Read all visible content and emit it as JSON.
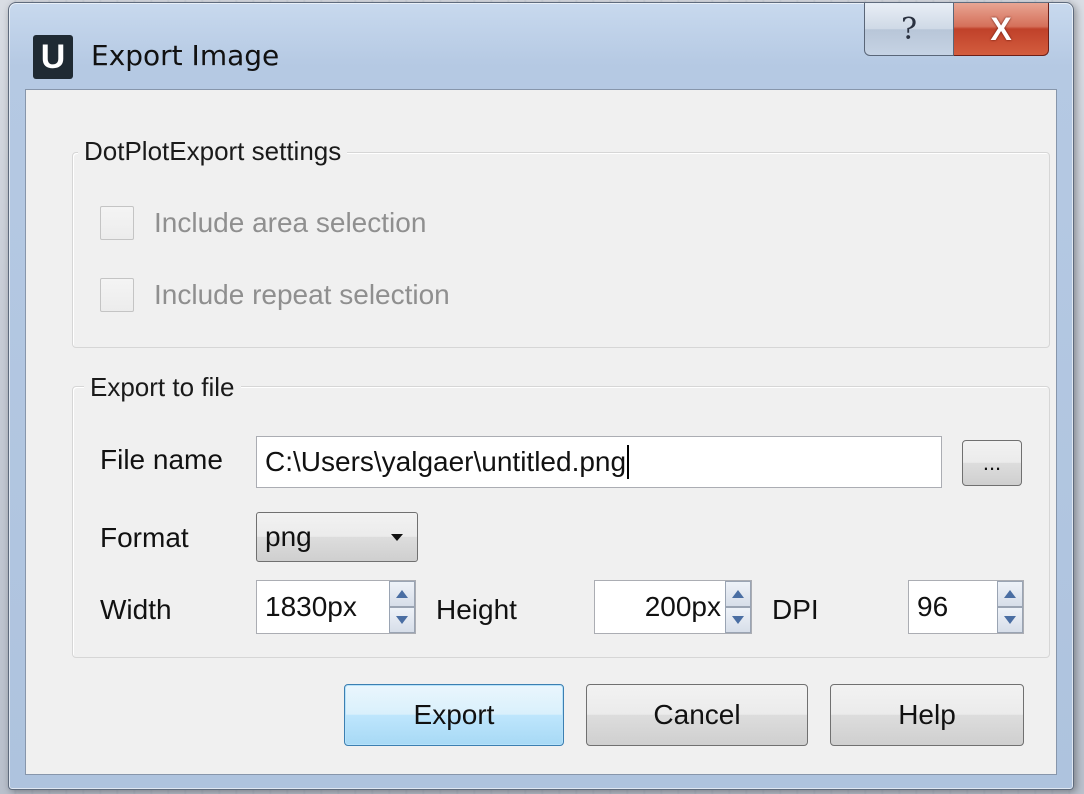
{
  "window": {
    "title": "Export Image",
    "app_icon_letter": "U",
    "help_glyph": "?",
    "close_glyph": "X"
  },
  "settings_group": {
    "title": "DotPlotExport settings",
    "include_area_label": "Include area selection",
    "include_repeat_label": "Include repeat selection",
    "include_area_checked": false,
    "include_repeat_checked": false
  },
  "export_group": {
    "title": "Export to file",
    "file_name_label": "File name",
    "file_name_value": "C:\\Users\\yalgaer\\untitled.png",
    "browse_label": "...",
    "format_label": "Format",
    "format_value": "png",
    "width_label": "Width",
    "width_value": "1830px",
    "height_label": "Height",
    "height_value": "200px",
    "dpi_label": "DPI",
    "dpi_value": "96"
  },
  "buttons": {
    "export": "Export",
    "cancel": "Cancel",
    "help": "Help"
  },
  "icons": {
    "app": "ugene-app-icon",
    "help": "help-question-icon",
    "close": "close-x-icon",
    "dropdown": "chevron-down-icon",
    "spin_up": "spin-up-arrow-icon",
    "spin_down": "spin-down-arrow-icon"
  },
  "colors": {
    "client_bg": "#f0f0f0",
    "close_button": "#c0412a",
    "default_button_border": "#3c7fb1",
    "disabled_text": "#8f8f8f"
  }
}
